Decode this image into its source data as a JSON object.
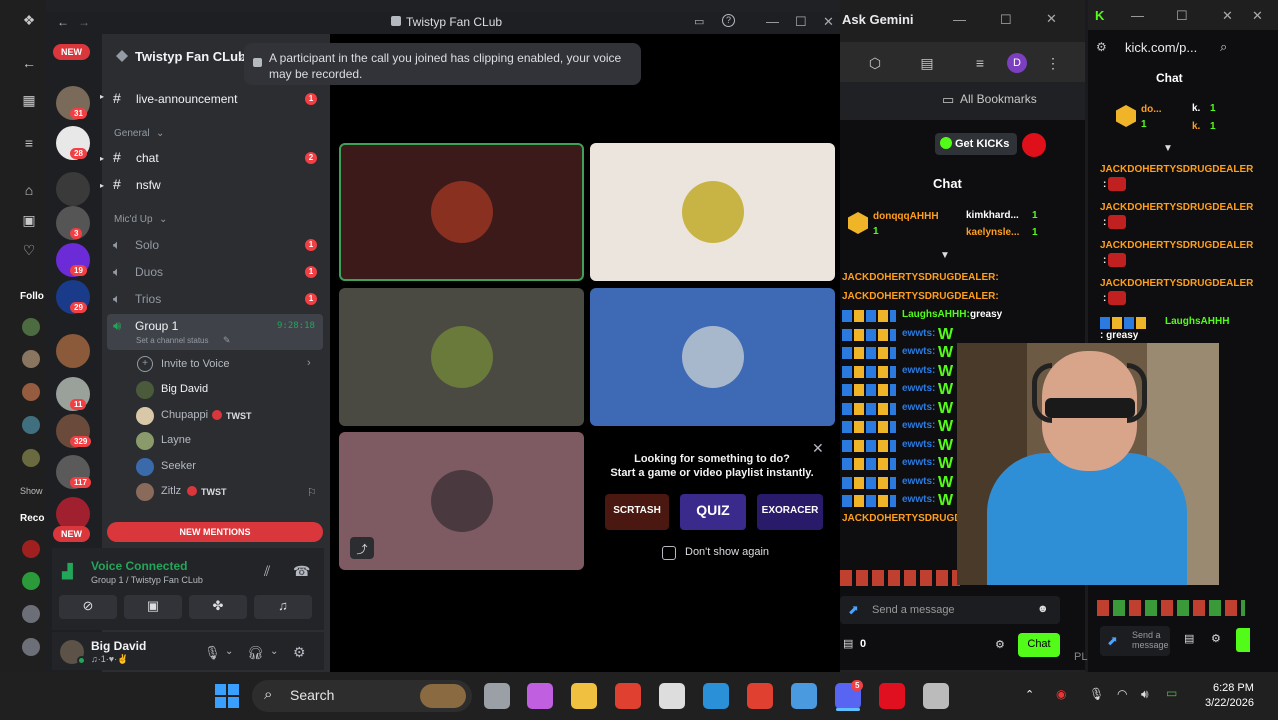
{
  "browser": {
    "gemini_label": "Ask Gemini",
    "bookmarks_label": "All Bookmarks",
    "left_sidebar_label_1": "Follo",
    "left_sidebar_label_2": "Show",
    "left_sidebar_label_3": "Reco",
    "profile_initial": "D"
  },
  "discord": {
    "window_title": "Twistyp Fan CLub",
    "server_name": "Twistyp Fan CLub",
    "toast": "A participant in the call you joined has clipping enabled, your voice may be recorded.",
    "new_label": "NEW",
    "new_label_bottom": "NEW",
    "server_badges": [
      "31",
      "28",
      "3",
      "19",
      "29",
      "11",
      "329",
      "117"
    ],
    "channels": {
      "live_announcement": "live-announcement",
      "live_announcement_badge": "1",
      "category_general": "General",
      "chat": "chat",
      "chat_badge": "2",
      "nsfw": "nsfw",
      "category_micd": "Mic'd Up",
      "solo": "Solo",
      "solo_badge": "1",
      "duos": "Duos",
      "duos_badge": "1",
      "trios": "Trios",
      "trios_badge": "1",
      "group1": "Group 1",
      "group1_timer": "9:28:18",
      "group1_status": "Set a channel status",
      "invite": "Invite to Voice"
    },
    "voice_users": [
      {
        "name": "Big David",
        "tag": ""
      },
      {
        "name": "Chupappi",
        "tag": "TWST"
      },
      {
        "name": "Layne",
        "tag": ""
      },
      {
        "name": "Seeker",
        "tag": ""
      },
      {
        "name": "Zitlz",
        "tag": "TWST"
      }
    ],
    "new_mentions": "NEW MENTIONS",
    "voice_connected": "Voice Connected",
    "voice_location": "Group 1 / Twistyp Fan CLub",
    "user_name": "Big David",
    "user_status": "♫·1·♥·✌",
    "activity_title": "Looking for something to do?",
    "activity_sub": "Start a game or video playlist instantly.",
    "activity_cards": [
      "SCRTASH",
      "QUIZ",
      "EXORACER"
    ],
    "dont_show": "Don't show again"
  },
  "kick_left": {
    "get_kicks": "Get KICKs",
    "chat_title": "Chat",
    "top_user_1": "donqqqAHHH",
    "top_user_1_val": "1",
    "top_user_2": "kimkhard...",
    "top_user_2_val": "1",
    "top_user_3": "kaelynsle...",
    "top_user_3_val": "1",
    "message_rows": [
      {
        "user": "JACKDOHERTYSDRUGDEALER:",
        "text": "",
        "orange": true
      },
      {
        "user": "JACKDOHERTYSDRUGDEALER:",
        "text": "",
        "orange": true
      },
      {
        "user": "LaughsAHHH:",
        "text": "greasy",
        "orange": false
      },
      {
        "user": "ewwts:",
        "text": "W",
        "orange": false
      },
      {
        "user": "ewwts:",
        "text": "W",
        "orange": false
      },
      {
        "user": "ewwts:",
        "text": "W",
        "orange": false
      },
      {
        "user": "ewwts:",
        "text": "W",
        "orange": false
      },
      {
        "user": "ewwts:",
        "text": "W",
        "orange": false
      },
      {
        "user": "ewwts:",
        "text": "W",
        "orange": false
      },
      {
        "user": "ewwts:",
        "text": "W",
        "orange": false
      },
      {
        "user": "ewwts:",
        "text": "W",
        "orange": false
      },
      {
        "user": "ewwts:",
        "text": "W",
        "orange": false
      },
      {
        "user": "ewwts:",
        "text": "W",
        "orange": false
      },
      {
        "user": "JACKDOHERTYSDRUGDE",
        "text": "",
        "orange": true
      }
    ],
    "send_placeholder": "Send a message",
    "kicks_count": "0",
    "chat_button": "Chat"
  },
  "kick_right": {
    "url": "kick.com/p...",
    "chat_title": "Chat",
    "top_user_1": "do...",
    "top_user_1_val": "1",
    "top_user_2": "k.",
    "top_user_2_val": "1",
    "top_user_3": "k.",
    "top_user_3_val": "1",
    "message_rows": [
      {
        "user": "JACKDOHERTYSDRUGDEALER",
        "text": ":",
        "orange": true
      },
      {
        "user": "JACKDOHERTYSDRUGDEALER",
        "text": ":",
        "orange": true
      },
      {
        "user": "JACKDOHERTYSDRUGDEALER",
        "text": ":",
        "orange": true
      },
      {
        "user": "JACKDOHERTYSDRUGDEALER",
        "text": ":",
        "orange": true
      },
      {
        "user": "LaughsAHHH",
        "text": ": greasy",
        "orange": false
      }
    ],
    "send_placeholder": "Send a message",
    "pl_label": "PL"
  },
  "taskbar": {
    "search_label": "Search",
    "time": "6:28 PM",
    "date": "3/22/2026",
    "discord_badge": "5"
  },
  "colors": {
    "discord_bg": "#2b2d31",
    "kick_green": "#53fc18",
    "danger": "#f23f43",
    "voice_green": "#23a55a"
  }
}
